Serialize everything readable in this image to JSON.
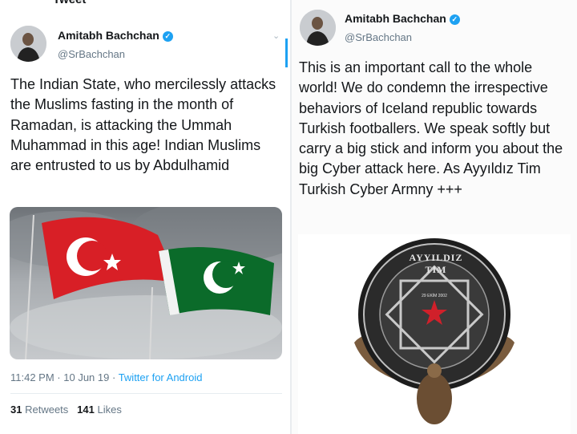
{
  "left_tweet": {
    "top_partial": "Tweet",
    "name": "Amitabh Bachchan",
    "handle": "@SrBachchan",
    "text": "The Indian State, who mercilessly attacks the Muslims fasting in the month of Ramadan, is attacking the Ummah Muhammad in this age! Indian Muslims are entrusted to us by Abdulhamid",
    "time": "11:42 PM",
    "date": "10 Jun 19",
    "source": "Twitter for Android",
    "retweets_count": "31",
    "retweets_label": "Retweets",
    "likes_count": "141",
    "likes_label": "Likes",
    "media": "turkey-pakistan-flags"
  },
  "right_tweet": {
    "name": "Amitabh Bachchan",
    "handle": "@SrBachchan",
    "text": "This is an important call to the whole world! We do condemn the irrespective behaviors of Iceland republic towards Turkish footballers. We speak softly but carry a big stick and inform you about the big Cyber attack here. As Ayyıldız Tim Turkish Cyber Armny +++",
    "media": "ayyildiz-tim-emblem",
    "emblem_text": "AYYILDIZ TIM",
    "emblem_small": "29 EKİM 2002"
  },
  "colors": {
    "accent": "#1da1f2",
    "text": "#14171a",
    "muted": "#657786"
  },
  "icons": [
    "verified-icon",
    "chevron-down-icon"
  ]
}
